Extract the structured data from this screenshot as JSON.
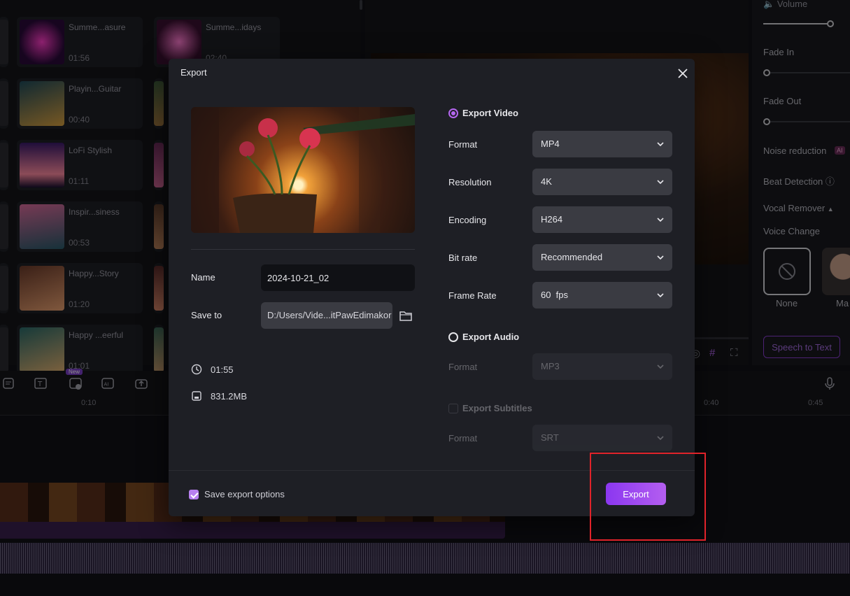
{
  "library": {
    "items": [
      {
        "title": "Summe...asure",
        "duration": "01:56",
        "colors": [
          "#2a0a3a",
          "#ff3cc8"
        ]
      },
      {
        "title": "Summe...idays",
        "duration": "02:40",
        "colors": [
          "#3a1030",
          "#ff7ad0"
        ]
      },
      {
        "title": "Playin...Guitar",
        "duration": "00:40",
        "colors": [
          "#1e4a5a",
          "#d8a040"
        ]
      },
      {
        "title": "LoFi Stylish",
        "duration": "01:11",
        "colors": [
          "#3a1a6a",
          "#ff8aa0"
        ]
      },
      {
        "title": "Inspir...siness",
        "duration": "00:53",
        "colors": [
          "#2a5a6a",
          "#d86a9a"
        ]
      },
      {
        "title": "Happy...Story",
        "duration": "01:20",
        "colors": [
          "#6a3a2a",
          "#e8a070"
        ]
      },
      {
        "title": "Happy ...eerful",
        "duration": "01:01",
        "colors": [
          "#2a6a6a",
          "#e0b070"
        ]
      }
    ]
  },
  "properties": {
    "volume": "Volume",
    "fade_in": "Fade In",
    "fade_out": "Fade Out",
    "noise_reduction": "Noise reduction",
    "beat_detection": "Beat Detection",
    "vocal_remover": "Vocal Remover",
    "voice_change": "Voice Change",
    "ai_badge": "AI",
    "voice_none": "None",
    "voice_next": "Ma",
    "speech_to_text": "Speech to Text"
  },
  "toolbar": {
    "new_badge": "New",
    "ai_icon_text": "AI"
  },
  "ruler": {
    "ticks": [
      "0:10",
      "0:40",
      "0:45"
    ]
  },
  "dialog": {
    "title": "Export",
    "name_label": "Name",
    "name_value": "2024-10-21_02",
    "save_to_label": "Save to",
    "save_to_value": "D:/Users/Vide...itPawEdimakor",
    "duration": "01:55",
    "size": "831.2MB",
    "export_video": {
      "label": "Export Video",
      "checked": true,
      "options": [
        {
          "label": "Format",
          "value": "MP4"
        },
        {
          "label": "Resolution",
          "value": "4K"
        },
        {
          "label": "Encoding",
          "value": "H264"
        },
        {
          "label": "Bit rate",
          "value": "Recommended"
        },
        {
          "label": "Frame Rate",
          "value": "60  fps"
        }
      ]
    },
    "export_audio": {
      "label": "Export Audio",
      "format_label": "Format",
      "format_value": "MP3"
    },
    "export_subtitles": {
      "label": "Export Subtitles",
      "format_label": "Format",
      "format_value": "SRT"
    },
    "save_export_options": "Save export options",
    "export_button": "Export"
  },
  "accent_color": "#b566f0",
  "highlight_color": "#e0232a"
}
